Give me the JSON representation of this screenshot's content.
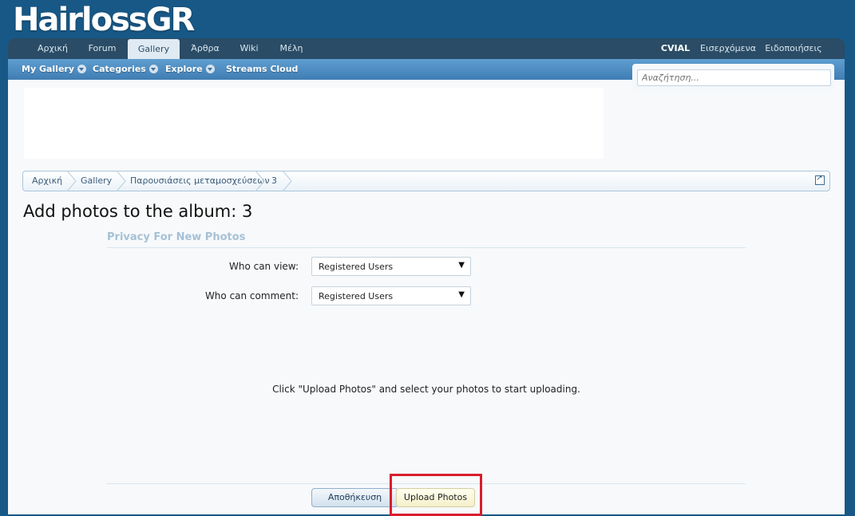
{
  "site": {
    "logo": "HairlossGR"
  },
  "nav": {
    "tabs": [
      {
        "label": "Αρχική"
      },
      {
        "label": "Forum"
      },
      {
        "label": "Gallery"
      },
      {
        "label": "Άρθρα"
      },
      {
        "label": "Wiki"
      },
      {
        "label": "Μέλη"
      }
    ],
    "user": "CVIAL",
    "inbox": "Εισερχόμενα",
    "alerts": "Ειδοποιήσεις"
  },
  "subnav": {
    "items": [
      {
        "label": "My Gallery"
      },
      {
        "label": "Categories"
      },
      {
        "label": "Explore"
      },
      {
        "label": "Streams Cloud"
      }
    ]
  },
  "search": {
    "placeholder": "Αναζήτηση..."
  },
  "breadcrumb": [
    {
      "label": "Αρχική"
    },
    {
      "label": "Gallery"
    },
    {
      "label": "Παρουσιάσεις μεταμοσχεύσεων"
    },
    {
      "label": "3"
    }
  ],
  "page": {
    "title": "Add photos to the album: 3",
    "section_title": "Privacy For New Photos",
    "fields": {
      "view_label": "Who can view:",
      "view_value": "Registered Users",
      "comment_label": "Who can comment:",
      "comment_value": "Registered Users"
    },
    "hint": "Click \"Upload Photos\" and select your photos to start uploading.",
    "save_button": "Αποθήκευση",
    "upload_button": "Upload Photos"
  },
  "colors": {
    "header_bg": "#185886",
    "nav_bg": "#2a4c66",
    "highlight": "#d81d2c"
  }
}
